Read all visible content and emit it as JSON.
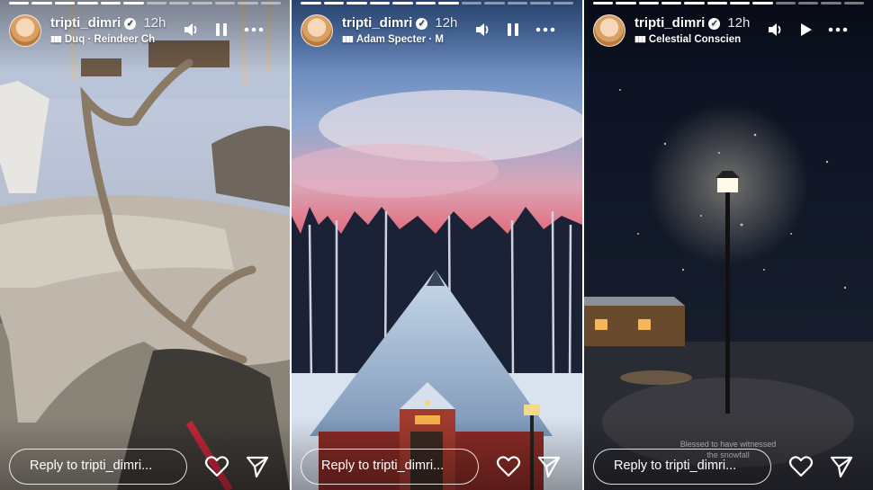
{
  "colors": {
    "text": "#ffffff",
    "page_background": "#ffffff"
  },
  "stories": [
    {
      "username": "tripti_dimri",
      "time": "12h",
      "music": "Duq · Reindeer Ch",
      "playback_icon": "pause-icon",
      "progress": {
        "segments": 12,
        "completed": 6
      },
      "reply_placeholder": "Reply to tripti_dimri...",
      "caption": ""
    },
    {
      "username": "tripti_dimri",
      "time": "12h",
      "music": "Adam Specter · M",
      "playback_icon": "pause-icon",
      "progress": {
        "segments": 12,
        "completed": 7
      },
      "reply_placeholder": "Reply to tripti_dimri...",
      "caption": ""
    },
    {
      "username": "tripti_dimri",
      "time": "12h",
      "music": "Celestial Conscien",
      "playback_icon": "play-icon",
      "progress": {
        "segments": 12,
        "completed": 8
      },
      "reply_placeholder": "Reply to tripti_dimri...",
      "caption": "Blessed to have witnessed the snowfall"
    }
  ]
}
